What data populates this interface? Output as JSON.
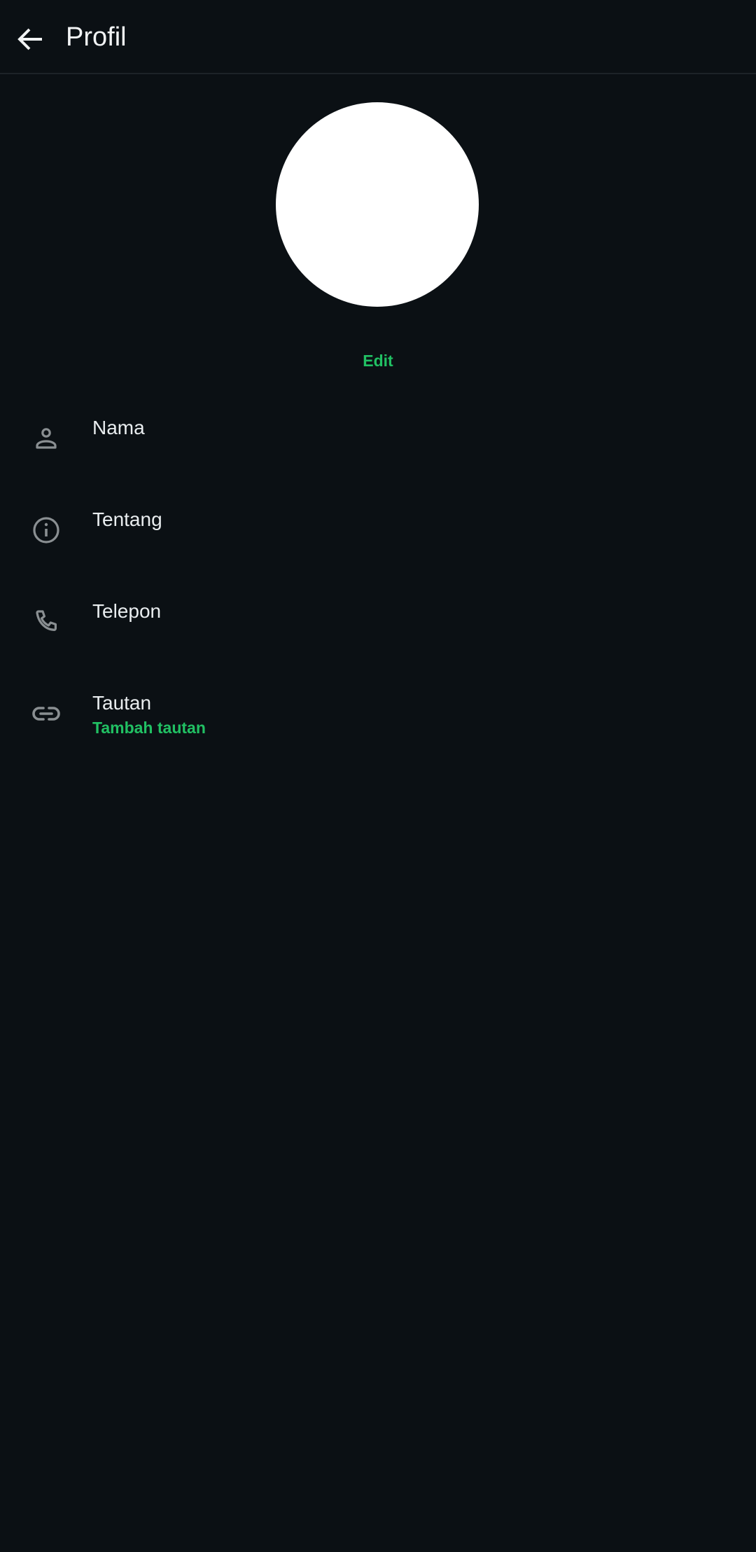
{
  "header": {
    "title": "Profil",
    "back_icon": "arrow-left-icon"
  },
  "profile": {
    "edit_label": "Edit"
  },
  "rows": [
    {
      "label": "Nama",
      "icon": "person-icon"
    },
    {
      "label": "Tentang",
      "icon": "info-icon"
    },
    {
      "label": "Telepon",
      "icon": "phone-icon"
    },
    {
      "label": "Tautan",
      "icon": "link-icon",
      "action": "Tambah tautan"
    }
  ],
  "colors": {
    "background": "#0b1014",
    "accent": "#21c063",
    "icon": "#8a8f92"
  }
}
